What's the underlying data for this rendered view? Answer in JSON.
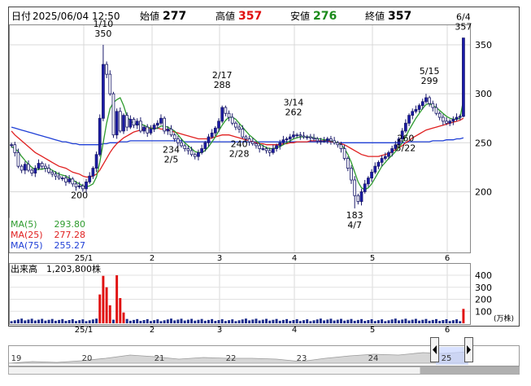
{
  "header": {
    "date_label": "日付",
    "date_value": "2025/06/04 12:50",
    "open_label": "始値",
    "open_value": "277",
    "high_label": "高値",
    "high_value": "357",
    "low_label": "安値",
    "low_value": "276",
    "close_label": "終値",
    "close_value": "357"
  },
  "legend": {
    "ma5_label": "MA(5)",
    "ma5_value": "293.80",
    "ma25_label": "MA(25)",
    "ma25_value": "277.28",
    "ma75_label": "MA(75)",
    "ma75_value": "255.27"
  },
  "volume_panel": {
    "label": "出来高",
    "value": "1,203,800株",
    "unit": "(万株)"
  },
  "colors": {
    "up": "#1a1aa8",
    "down": "#ffffff",
    "ma5": "#2e9b2e",
    "ma25": "#e02020",
    "ma75": "#1f3fd6",
    "vol_normal": "#1a2a8a",
    "vol_high": "#e01010"
  },
  "chart_data": [
    {
      "type": "candlestick",
      "y_ticks": [
        "350",
        "300",
        "250",
        "200"
      ],
      "ylim": [
        138,
        370
      ],
      "x_ticks": [
        "25/1",
        "2",
        "3",
        "4",
        "5",
        "6"
      ],
      "annotations": [
        {
          "date": "1/10",
          "value": "350"
        },
        {
          "date": "2/17",
          "value": "288"
        },
        {
          "date": "3/14",
          "value": "262"
        },
        {
          "date": "6/4",
          "value": "357"
        },
        {
          "date": "5/15",
          "value": "299"
        },
        {
          "date": "2/5",
          "value": "234"
        },
        {
          "date": "2/28",
          "value": "240"
        },
        {
          "date": "4/7",
          "value": "183"
        },
        {
          "date": "5/22",
          "value": "260"
        },
        {
          "date": "",
          "value": "200"
        }
      ],
      "close": [
        248,
        240,
        226,
        222,
        228,
        222,
        219,
        224,
        229,
        226,
        224,
        220,
        218,
        216,
        214,
        214,
        210,
        213,
        208,
        205,
        206,
        203,
        210,
        216,
        224,
        238,
        275,
        330,
        320,
        300,
        258,
        282,
        262,
        278,
        266,
        274,
        268,
        272,
        262,
        266,
        260,
        264,
        268,
        270,
        275,
        262,
        264,
        258,
        254,
        250,
        247,
        244,
        242,
        238,
        236,
        240,
        244,
        250,
        256,
        260,
        265,
        272,
        286,
        280,
        276,
        270,
        266,
        264,
        256,
        254,
        251,
        249,
        247,
        244,
        244,
        242,
        240,
        244,
        247,
        250,
        253,
        254,
        256,
        258,
        258,
        257,
        256,
        256,
        255,
        254,
        252,
        252,
        252,
        254,
        252,
        250,
        248,
        244,
        234,
        224,
        212,
        196,
        190,
        200,
        208,
        214,
        220,
        226,
        230,
        234,
        236,
        240,
        244,
        248,
        254,
        262,
        270,
        278,
        282,
        284,
        288,
        292,
        296,
        290,
        286,
        280,
        276,
        272,
        270,
        272,
        274,
        276,
        277,
        357
      ],
      "ma5": [
        246,
        244,
        241,
        236,
        232,
        228,
        225,
        222,
        223,
        223,
        224,
        224,
        222,
        220,
        218,
        217,
        216,
        214,
        212,
        210,
        208,
        206,
        205,
        206,
        208,
        215,
        230,
        250,
        270,
        285,
        291,
        294,
        296,
        288,
        277,
        272,
        270,
        269,
        269,
        268,
        266,
        265,
        264,
        265,
        267,
        267,
        266,
        264,
        262,
        258,
        254,
        250,
        247,
        244,
        241,
        240,
        240,
        242,
        246,
        251,
        256,
        262,
        268,
        273,
        276,
        276,
        274,
        270,
        266,
        262,
        258,
        255,
        252,
        249,
        247,
        245,
        244,
        244,
        245,
        246,
        248,
        250,
        252,
        254,
        255,
        256,
        256,
        256,
        256,
        255,
        254,
        254,
        253,
        253,
        252,
        251,
        250,
        248,
        244,
        238,
        230,
        220,
        210,
        204,
        202,
        204,
        208,
        214,
        220,
        226,
        230,
        234,
        237,
        241,
        245,
        250,
        256,
        263,
        269,
        275,
        280,
        285,
        289,
        290,
        288,
        286,
        283,
        280,
        277,
        275,
        274,
        274,
        275,
        294
      ],
      "ma25": [
        262,
        258,
        255,
        252,
        249,
        246,
        243,
        240,
        238,
        236,
        234,
        232,
        230,
        228,
        226,
        225,
        224,
        222,
        220,
        219,
        218,
        216,
        215,
        215,
        216,
        218,
        222,
        228,
        234,
        240,
        245,
        249,
        252,
        255,
        257,
        259,
        261,
        262,
        263,
        264,
        265,
        265,
        265,
        265,
        264,
        264,
        263,
        262,
        261,
        260,
        259,
        258,
        257,
        256,
        255,
        254,
        254,
        254,
        254,
        255,
        256,
        257,
        258,
        258,
        258,
        257,
        256,
        255,
        254,
        253,
        252,
        251,
        250,
        249,
        249,
        248,
        248,
        248,
        248,
        248,
        249,
        249,
        250,
        250,
        251,
        251,
        251,
        251,
        252,
        252,
        252,
        252,
        252,
        252,
        251,
        251,
        250,
        249,
        248,
        246,
        244,
        242,
        240,
        238,
        237,
        236,
        236,
        236,
        236,
        237,
        238,
        239,
        241,
        243,
        245,
        247,
        250,
        252,
        255,
        257,
        259,
        261,
        263,
        264,
        265,
        266,
        267,
        268,
        269,
        270,
        271,
        272,
        273,
        275
      ],
      "ma75": [
        266,
        265,
        264,
        263,
        262,
        261,
        260,
        259,
        258,
        257,
        256,
        255,
        254,
        253,
        252,
        251,
        251,
        250,
        249,
        249,
        248,
        248,
        248,
        248,
        248,
        248,
        248,
        249,
        249,
        250,
        250,
        250,
        251,
        251,
        251,
        252,
        252,
        252,
        252,
        252,
        252,
        252,
        252,
        252,
        252,
        252,
        252,
        252,
        252,
        252,
        252,
        251,
        251,
        251,
        251,
        251,
        251,
        251,
        251,
        251,
        251,
        251,
        251,
        251,
        251,
        251,
        251,
        251,
        251,
        251,
        251,
        251,
        251,
        251,
        251,
        251,
        251,
        251,
        251,
        251,
        251,
        251,
        251,
        251,
        251,
        251,
        251,
        251,
        251,
        251,
        251,
        251,
        251,
        251,
        251,
        251,
        250,
        250,
        250,
        250,
        250,
        250,
        250,
        250,
        250,
        250,
        250,
        250,
        250,
        250,
        250,
        250,
        250,
        250,
        250,
        250,
        250,
        251,
        251,
        251,
        251,
        251,
        251,
        251,
        252,
        252,
        252,
        252,
        253,
        253,
        253,
        254,
        254,
        255
      ],
      "volume_scale": [
        0,
        400
      ]
    }
  ]
}
